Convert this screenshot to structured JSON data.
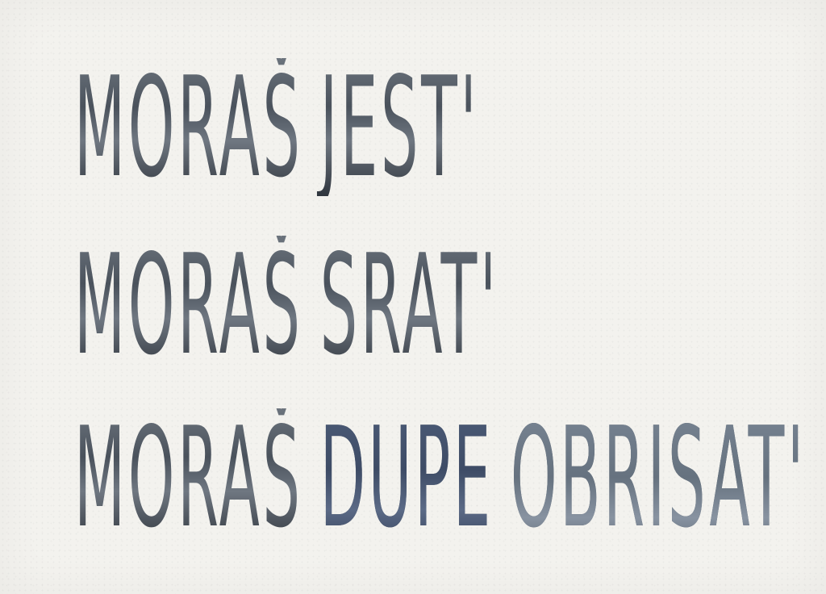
{
  "text": {
    "line1": [
      "MORAŠ",
      "JEST'"
    ],
    "line2": [
      "MORAŠ",
      "SRAT'"
    ],
    "line3": [
      "MORAŠ",
      "DUPE",
      "OBRISAT'"
    ]
  },
  "colors": {
    "paper": "#f3f2ee",
    "ink_grey": "#4a525c",
    "ink_dark": "#2f353d",
    "ink_blue": "#3e4c66"
  }
}
